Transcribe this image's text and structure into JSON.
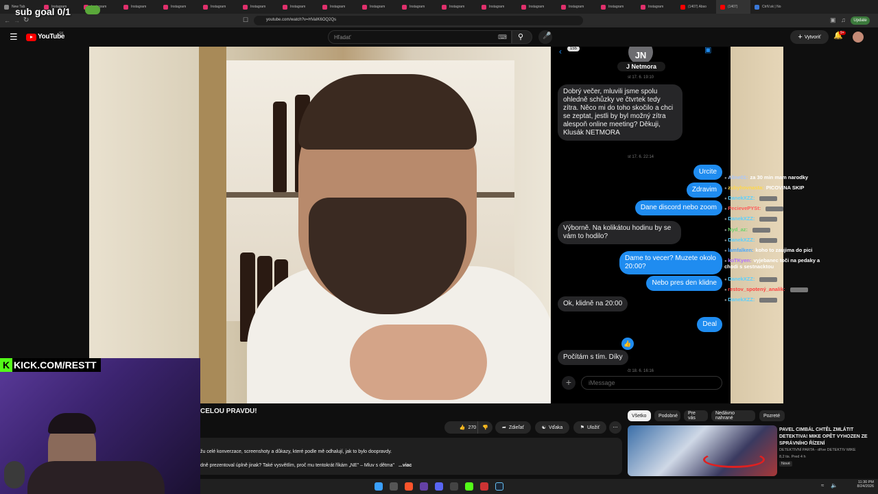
{
  "browser": {
    "tabs": [
      {
        "label": "New Tab",
        "color": "#888888"
      },
      {
        "label": "Instagram",
        "color": "#e1306c"
      },
      {
        "label": "Instagram",
        "color": "#e1306c"
      },
      {
        "label": "Instagram",
        "color": "#e1306c"
      },
      {
        "label": "Instagram",
        "color": "#e1306c"
      },
      {
        "label": "Instagram",
        "color": "#e1306c"
      },
      {
        "label": "Instagram",
        "color": "#e1306c"
      },
      {
        "label": "Instagram",
        "color": "#e1306c"
      },
      {
        "label": "Instagram",
        "color": "#e1306c"
      },
      {
        "label": "Instagram",
        "color": "#e1306c"
      },
      {
        "label": "Instagram",
        "color": "#e1306c"
      },
      {
        "label": "Instagram",
        "color": "#e1306c"
      },
      {
        "label": "Instagram",
        "color": "#e1306c"
      },
      {
        "label": "Instagram",
        "color": "#e1306c"
      },
      {
        "label": "Instagram",
        "color": "#e1306c"
      },
      {
        "label": "Instagram",
        "color": "#e1306c"
      },
      {
        "label": "Instagram",
        "color": "#e1306c"
      },
      {
        "label": "(1407) Abso",
        "color": "#ff0000"
      },
      {
        "label": "(1407)",
        "color": "#ff0000",
        "active": true
      },
      {
        "label": "CtrlV.sk | No",
        "color": "#3a78d8"
      }
    ],
    "url": "youtube.com/watch?v=HVaIK6OQ2Qs",
    "update_label": "Update"
  },
  "overlay": {
    "sub_goal": "sub goal 0/1",
    "kick_label": "KICK.COM/RESTT"
  },
  "youtube": {
    "logo": "YouTube",
    "region": "SK",
    "search_placeholder": "Hľadať",
    "create_label": "Vytvoriť",
    "notif_count": "9+"
  },
  "phone_chat": {
    "contact_initials": "JN",
    "contact_name": "J Netmora",
    "back_count": "155",
    "messages": [
      {
        "kind": "ts",
        "text": "st 17. 6. 19:10"
      },
      {
        "kind": "in",
        "text": "Dobrý večer, mluvili jsme spolu ohledně schůzky ve čtvrtek tedy zítra. Něco mi do toho skočilo a chci se zeptat, jestli by byl možný zítra alespoň online meeting? Děkuji, Klusák NETMORA"
      },
      {
        "kind": "ts",
        "text": "st 17. 6. 22:14"
      },
      {
        "kind": "out",
        "text": "Urcite"
      },
      {
        "kind": "out",
        "text": "Zdravim"
      },
      {
        "kind": "out",
        "text": "Dane discord nebo zoom"
      },
      {
        "kind": "in",
        "text": "Výborně. Na kolikátou hodinu by se vám to hodilo?"
      },
      {
        "kind": "out",
        "text": "Dame to vecer? Muzete okolo 20:00?"
      },
      {
        "kind": "out",
        "text": "Nebo pres den klidne"
      },
      {
        "kind": "in",
        "text": "Ok, klidně na 20:00"
      },
      {
        "kind": "out",
        "text": "Deal"
      },
      {
        "kind": "in",
        "text": "Počítám s tím. Díky"
      },
      {
        "kind": "ts",
        "text": "čt 18. 6. 16:16"
      }
    ],
    "input_placeholder": "iMessage"
  },
  "live_chat": [
    {
      "user": "Aline01:",
      "msg": "za 30 min mam narodky",
      "color": "#a9c7ff"
    },
    {
      "user": "zubyhovnasta:",
      "msg": "PICOVINA SKIP",
      "color": "#ffd84a"
    },
    {
      "user": "DanekXZZ:",
      "msg": "",
      "color": "#5ad0ff"
    },
    {
      "user": "PecievePYSt:",
      "msg": "",
      "color": "#ff5a5a"
    },
    {
      "user": "DanekXZZ:",
      "msg": "",
      "color": "#5ad0ff"
    },
    {
      "user": "Nyd_az:",
      "msg": "",
      "color": "#6ad46a"
    },
    {
      "user": "DanekXZZ:",
      "msg": "",
      "color": "#5ad0ff"
    },
    {
      "user": "lamfalken:",
      "msg": "koho to zaujima do pici",
      "color": "#4aa8ff"
    },
    {
      "user": "koTKyen:",
      "msg": "vyjebanec toči na pedaky a chodi s sestnacktou",
      "color": "#b070ff"
    },
    {
      "user": "DanekXZZ:",
      "msg": "",
      "color": "#5ad0ff"
    },
    {
      "user": "restov_spotený_analik:",
      "msg": "",
      "color": "#ff4040"
    },
    {
      "user": "DanekXZZ:",
      "msg": "",
      "color": "#5ad0ff"
    }
  ],
  "video_info": {
    "title": "CELOU PRAVDU!",
    "like_count": "270",
    "share_label": "Zdieľať",
    "thanks_label": "Vďaka",
    "save_label": "Uložiť",
    "desc_line1": "žu celé konverzace, screenshoty a důkazy, které podle mě odhalují, jak to bylo doopravdy.",
    "desc_line2": "dně prezentoval úplně jinak? Také vysvětlím, proč mu tentokrát říkám „NE\" – Mluv s dětma\"",
    "desc_more": "...viac"
  },
  "recommend": {
    "chips": [
      "Všetko",
      "Podobné",
      "Pre vás",
      "Nedávno nahrané",
      "Pozreté"
    ],
    "card_title": "PAVEL CIMBÁL CHTĚL ZMLÁTIT DETEKTIVA! MIKE OPĚT VYHOZEN ZE SPRÁVNÍHO ŘÍZENÍ",
    "card_channel": "DETEKTIVNÍ PARTA - dříve DETEKTIV MIKE",
    "card_meta": "8,2 tis. Pred 4 h",
    "card_badge": "Nové"
  },
  "taskbar": {
    "time": "11:30 PM",
    "date": "8/24/2026"
  },
  "colors": {
    "yt_red": "#ff0000",
    "imessage_blue": "#1f8cf0",
    "kick_green": "#53fc18"
  }
}
